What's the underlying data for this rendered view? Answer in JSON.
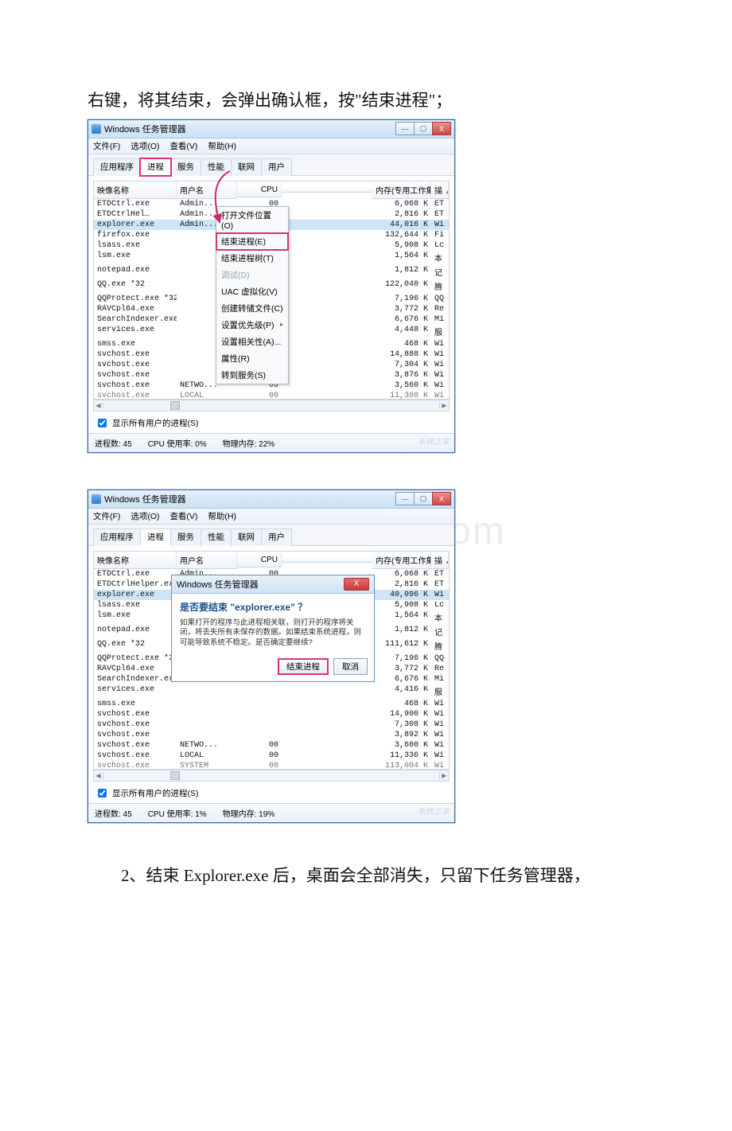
{
  "doc": {
    "para1": "右键，将其结束，会弹出确认框，按\"结束进程\"；",
    "para2": "2、结束 Explorer.exe 后，桌面会全部消失，只留下任务管理器，"
  },
  "watermark_page": "www.bdo...com",
  "win_title": "Windows 任务管理器",
  "menus": {
    "file": "文件(F)",
    "options": "选项(O)",
    "view": "查看(V)",
    "help": "帮助(H)"
  },
  "tabs": {
    "apps": "应用程序",
    "procs": "进程",
    "services": "服务",
    "perf": "性能",
    "net": "联网",
    "users": "用户"
  },
  "columns": {
    "name": "映像名称",
    "user": "用户名",
    "cpu": "CPU",
    "mem": "内存(专用工作集)",
    "desc": "描   "
  },
  "wbtn": {
    "min": "—",
    "max": "▢",
    "close": "X"
  },
  "scroll": {
    "left": "◀",
    "right": "▶"
  },
  "ctxm": {
    "open_loc": "打开文件位置(O)",
    "end_proc": "结束进程(E)",
    "end_tree": "结束进程树(T)",
    "debug": "调试(D)",
    "uac": "UAC 虚拟化(V)",
    "dump": "创建转储文件(C)",
    "priority": "设置优先级(P)",
    "affinity": "设置相关性(A)...",
    "props": "属性(R)",
    "goto_svc": "转到服务(S)"
  },
  "dlg": {
    "title": "Windows 任务管理器",
    "question": "是否要结束 \"explorer.exe\" ？",
    "body": "如果打开的程序与此进程相关联，则打开的程序将关闭，将丢失所有未保存的数据。如果结束系统进程，则可能导致系统不稳定。是否确定要继续?",
    "ok": "结束进程",
    "cancel": "取消"
  },
  "chk": {
    "label": "显示所有用户的进程(S)"
  },
  "status1": {
    "procs": "进程数: 45",
    "cpu": "CPU 使用率: 0%",
    "mem": "物理内存: 22%"
  },
  "status2": {
    "procs": "进程数: 45",
    "cpu": "CPU 使用率: 1%",
    "mem": "物理内存: 19%"
  },
  "wm_small": "系统之家",
  "proc1": [
    {
      "name": "ETDCtrl.exe",
      "user": "Admin...",
      "cpu": "00",
      "mem": "6,068 K",
      "d": "ET"
    },
    {
      "name": "ETDCtrlHel…",
      "user": "Admin...",
      "cpu": "00",
      "mem": "2,816 K",
      "d": "ET"
    },
    {
      "name": "explorer.exe",
      "user": "Admin...",
      "cpu": "00",
      "mem": "44,016 K",
      "d": "Wi",
      "sel": true
    },
    {
      "name": "firefox.exe",
      "user": "",
      "cpu": "",
      "mem": "132,644 K",
      "d": "Fi"
    },
    {
      "name": "lsass.exe",
      "user": "",
      "cpu": "",
      "mem": "5,908 K",
      "d": "Lc"
    },
    {
      "name": "lsm.exe",
      "user": "",
      "cpu": "",
      "mem": "1,564 K",
      "d": "本"
    },
    {
      "name": "notepad.exe",
      "user": "",
      "cpu": "",
      "mem": "1,812 K",
      "d": "记"
    },
    {
      "name": "QQ.exe *32",
      "user": "",
      "cpu": "",
      "mem": "122,040 K",
      "d": "腾"
    },
    {
      "name": "QQProtect.exe *32",
      "user": "",
      "cpu": "",
      "mem": "7,196 K",
      "d": "QQ"
    },
    {
      "name": "RAVCpl64.exe",
      "user": "",
      "cpu": "",
      "mem": "3,772 K",
      "d": "Re"
    },
    {
      "name": "SearchIndexer.exe",
      "user": "",
      "cpu": "",
      "mem": "6,676 K",
      "d": "Mi"
    },
    {
      "name": "services.exe",
      "user": "",
      "cpu": "",
      "mem": "4,448 K",
      "d": "服"
    },
    {
      "name": "smss.exe",
      "user": "",
      "cpu": "",
      "mem": "468 K",
      "d": "Wi"
    },
    {
      "name": "svchost.exe",
      "user": "",
      "cpu": "",
      "mem": "14,888 K",
      "d": "Wi"
    },
    {
      "name": "svchost.exe",
      "user": "",
      "cpu": "",
      "mem": "7,304 K",
      "d": "Wi"
    },
    {
      "name": "svchost.exe",
      "user": "",
      "cpu": "",
      "mem": "3,876 K",
      "d": "Wi"
    },
    {
      "name": "svchost.exe",
      "user": "NETWO...",
      "cpu": "00",
      "mem": "3,560 K",
      "d": "Wi"
    },
    {
      "name": "svchost.exe",
      "user": "LOCAL",
      "cpu": "00",
      "mem": "11,308 K",
      "d": "Wi"
    }
  ],
  "proc2": [
    {
      "name": "ETDCtrl.exe",
      "user": "Admin...",
      "cpu": "00",
      "mem": "6,068 K",
      "d": "ET"
    },
    {
      "name": "ETDCtrlHelper.exe",
      "user": "Admin...",
      "cpu": "00",
      "mem": "2,816 K",
      "d": "ET"
    },
    {
      "name": "explorer.exe",
      "user": "Admin...",
      "cpu": "00",
      "mem": "40,096 K",
      "d": "Wi",
      "sel": true
    },
    {
      "name": "lsass.exe",
      "user": "",
      "cpu": "",
      "mem": "5,908 K",
      "d": "Lc"
    },
    {
      "name": "lsm.exe",
      "user": "",
      "cpu": "",
      "mem": "1,564 K",
      "d": "本"
    },
    {
      "name": "notepad.exe",
      "user": "",
      "cpu": "",
      "mem": "1,812 K",
      "d": "记"
    },
    {
      "name": "QQ.exe *32",
      "user": "",
      "cpu": "",
      "mem": "111,612 K",
      "d": "腾"
    },
    {
      "name": "QQProtect.exe *32",
      "user": "",
      "cpu": "",
      "mem": "7,196 K",
      "d": "QQ"
    },
    {
      "name": "RAVCpl64.exe",
      "user": "",
      "cpu": "",
      "mem": "3,772 K",
      "d": "Re"
    },
    {
      "name": "SearchIndexer.exe",
      "user": "",
      "cpu": "",
      "mem": "6,676 K",
      "d": "Mi"
    },
    {
      "name": "services.exe",
      "user": "",
      "cpu": "",
      "mem": "4,416 K",
      "d": "服"
    },
    {
      "name": "smss.exe",
      "user": "",
      "cpu": "",
      "mem": "468 K",
      "d": "Wi"
    },
    {
      "name": "svchost.exe",
      "user": "",
      "cpu": "",
      "mem": "14,900 K",
      "d": "Wi"
    },
    {
      "name": "svchost.exe",
      "user": "",
      "cpu": "",
      "mem": "7,308 K",
      "d": "Wi"
    },
    {
      "name": "svchost.exe",
      "user": "",
      "cpu": "",
      "mem": "3,892 K",
      "d": "Wi"
    },
    {
      "name": "svchost.exe",
      "user": "NETWO...",
      "cpu": "00",
      "mem": "3,600 K",
      "d": "Wi"
    },
    {
      "name": "svchost.exe",
      "user": "LOCAL",
      "cpu": "00",
      "mem": "11,336 K",
      "d": "Wi"
    },
    {
      "name": "svchost.exe",
      "user": "SYSTEM",
      "cpu": "00",
      "mem": "113,004 K",
      "d": "Wi"
    }
  ]
}
